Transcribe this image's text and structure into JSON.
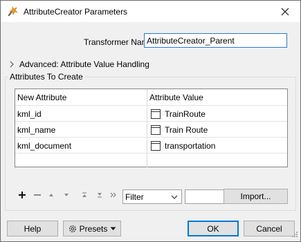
{
  "window": {
    "title": "AttributeCreator Parameters",
    "title_icon": "fme-transformer-icon",
    "close_icon": "close-icon"
  },
  "transformer_name": {
    "label": "Transformer Name:",
    "value": "AttributeCreator_Parent"
  },
  "advanced": {
    "label": "Advanced: Attribute Value Handling",
    "expanded": false
  },
  "attributes_group": {
    "label": "Attributes To Create",
    "columns": [
      "New Attribute",
      "Attribute Value"
    ],
    "rows": [
      {
        "name": "kml_id",
        "value": "TrainRoute",
        "value_icon": "text-value-icon"
      },
      {
        "name": "kml_name",
        "value": "Train Route",
        "value_icon": "text-value-icon"
      },
      {
        "name": "kml_document",
        "value": "transportation",
        "value_icon": "text-value-icon"
      }
    ]
  },
  "toolbar": {
    "add_icon": "plus-icon",
    "remove_icon": "minus-icon",
    "up_icon": "move-up-icon",
    "down_icon": "move-down-icon",
    "top_icon": "move-top-icon",
    "bottom_icon": "move-bottom-icon",
    "more_icon": "more-icon",
    "filter_value": "Filter",
    "filter_text": "",
    "import_label": "Import..."
  },
  "footer": {
    "help_label": "Help",
    "presets_label": "Presets",
    "ok_label": "OK",
    "cancel_label": "Cancel"
  },
  "colors": {
    "accent": "#0078d7",
    "window_bg": "#f0f0f0",
    "input_border": "#2a78d6"
  }
}
